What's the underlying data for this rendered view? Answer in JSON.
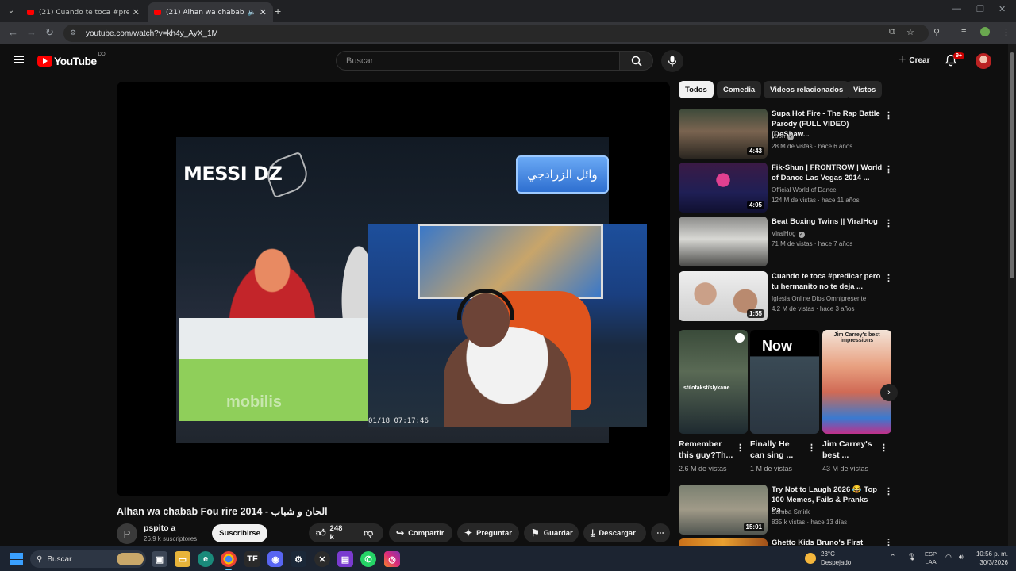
{
  "browser": {
    "tabs": [
      {
        "title": "(21) Cuando te toca #predicar p",
        "active": false
      },
      {
        "title": "(21) Alhan wa chabab Fou r",
        "active": true
      }
    ],
    "url": "youtube.com/watch?v=kh4y_AyX_1M"
  },
  "youtube": {
    "logo_text": "YouTube",
    "country_code": "DO",
    "search_placeholder": "Buscar",
    "create_label": "Crear",
    "notifications_badge": "9+"
  },
  "video": {
    "overlay_brand": "MESSI DZ",
    "overlay_arabic": "وائل الزرادجي",
    "desk_logo": "mobilis",
    "timestamp": "01/18 07:17:46",
    "title": "Alhan wa chabab Fou rire 2014 - الحان و شباب",
    "channel_initial": "P",
    "channel_name": "pspito a",
    "subscribers": "26.9 k suscriptores",
    "subscribe_label": "Suscribirse",
    "likes": "248 k",
    "share_label": "Compartir",
    "ask_label": "Preguntar",
    "save_label": "Guardar",
    "download_label": "Descargar"
  },
  "chips": [
    "Todos",
    "Comedia",
    "Videos relacionados",
    "Vistos"
  ],
  "recommendations": [
    {
      "title": "Supa Hot Fire - The Rap Battle Parody (FULL VIDEO) [DeShaw...",
      "channel": "yoon",
      "verified": true,
      "meta": "28 M de vistas · hace 6 años",
      "duration": "4:43"
    },
    {
      "title": "Fik-Shun | FRONTROW | World of Dance Las Vegas 2014 ...",
      "channel": "Official World of Dance",
      "verified": false,
      "meta": "124 M de vistas · hace 11 años",
      "duration": "4:05"
    },
    {
      "title": "Beat Boxing Twins || ViralHog",
      "channel": "ViralHog",
      "verified": true,
      "meta": "71 M de vistas · hace 7 años",
      "duration": ""
    },
    {
      "title": "Cuando te toca #predicar pero tu hermanito no te deja ...",
      "channel": "Iglesia Online Dios Omnipresente",
      "verified": false,
      "meta": "4.2 M de vistas · hace 3 años",
      "duration": "1:55"
    },
    {
      "title": "Try Not to Laugh 2026 😂 Top 100 Memes, Fails & Pranks Pa...",
      "channel": "Samba Smirk",
      "verified": false,
      "meta": "835 k vistas · hace 13 días",
      "duration": "15:01"
    },
    {
      "title": "Ghetto Kids Bruno's First Golden",
      "channel": "",
      "verified": false,
      "meta": "",
      "duration": ""
    }
  ],
  "shorts": [
    {
      "title_line1": "Remember",
      "title_line2": "this guy?Th...",
      "views": "2.6 M de vistas",
      "overlay": "stilofakst/slykane"
    },
    {
      "title_line1": "Finally He",
      "title_line2": "can sing ...",
      "views": "1 M de vistas",
      "overlay": "Now"
    },
    {
      "title_line1": "Jim Carrey's",
      "title_line2": "best ...",
      "views": "43 M de vistas",
      "overlay": "Jim Carrey's best impressions"
    }
  ],
  "taskbar": {
    "search": "Buscar",
    "temperature": "23°C",
    "weather": "Despejado",
    "lang1": "ESP",
    "lang2": "LAA",
    "time": "10:56 p. m.",
    "date": "30/3/2026"
  }
}
